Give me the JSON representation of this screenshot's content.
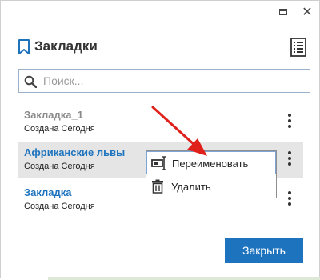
{
  "window": {
    "maximize_icon": "maximize-icon",
    "close_icon": "close-icon",
    "close_glyph": "✕"
  },
  "header": {
    "title": "Закладки",
    "bookmark_icon": "bookmark-icon",
    "list_icon": "list-icon",
    "accent": "#1e73be"
  },
  "search": {
    "placeholder": "Поиск...",
    "value": ""
  },
  "bookmarks": [
    {
      "title": "Закладка_1",
      "subtitle": "Создана Сегодня",
      "title_color": "#8a8a8a",
      "selected": false
    },
    {
      "title": "Африканские львы",
      "subtitle": "Создана Сегодня",
      "title_color": "#1e73be",
      "selected": true
    },
    {
      "title": "Закладка",
      "subtitle": "Создана Сегодня",
      "title_color": "#1e73be",
      "selected": false
    }
  ],
  "context_menu": {
    "items": [
      {
        "label": "Переименовать",
        "icon": "rename-icon",
        "highlighted": true
      },
      {
        "label": "Удалить",
        "icon": "trash-icon",
        "highlighted": false
      }
    ]
  },
  "footer": {
    "close_label": "Закрыть",
    "close_color": "#1e73be"
  },
  "annotation": {
    "arrow_color": "#e0201a"
  }
}
